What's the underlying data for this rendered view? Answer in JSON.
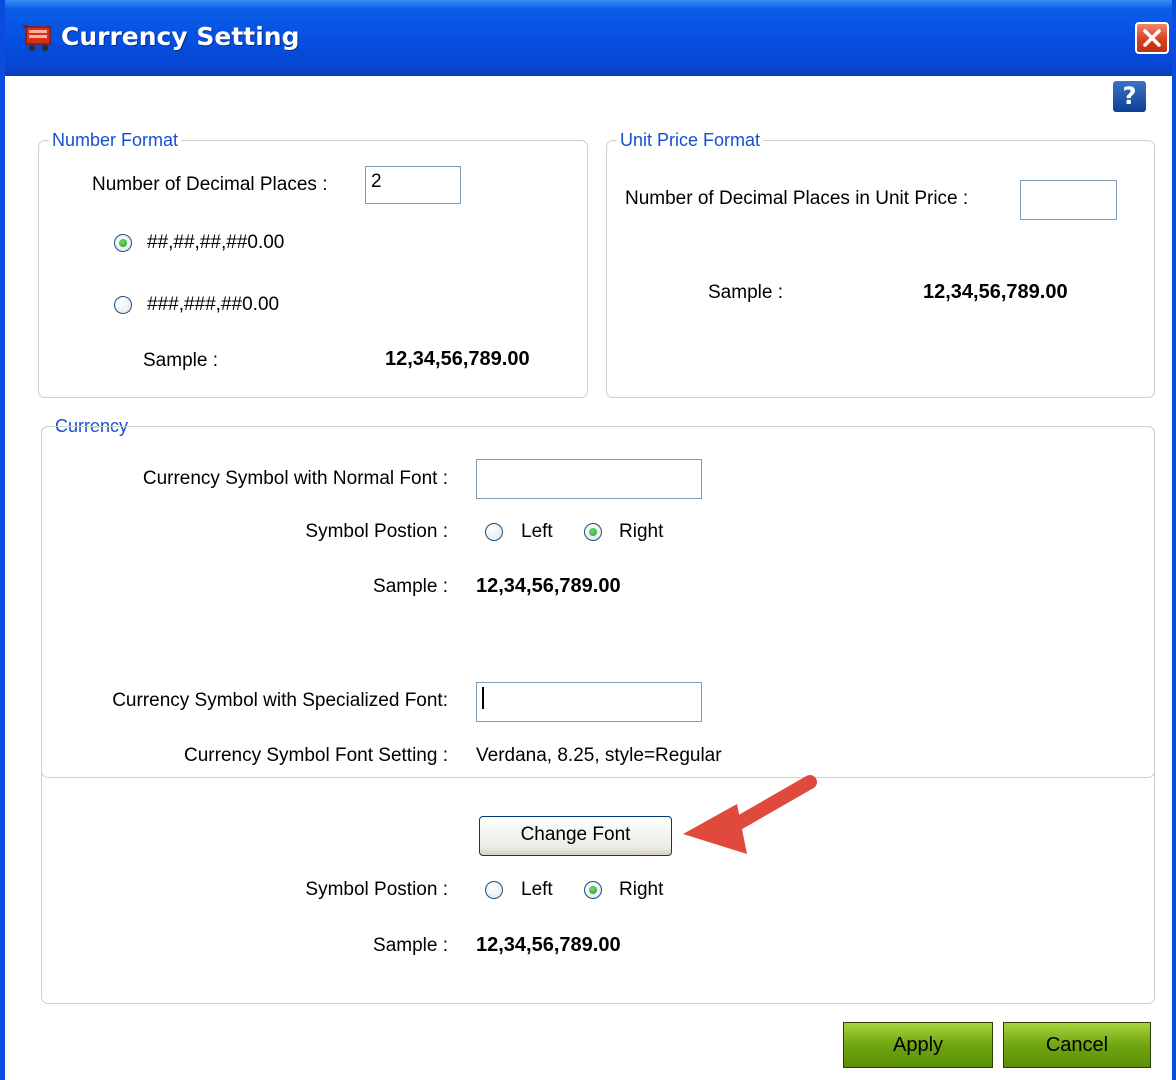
{
  "window": {
    "title": "Currency Setting",
    "help_label": "?"
  },
  "number_format": {
    "legend": "Number Format",
    "decimal_label": "Number of Decimal Places :",
    "decimal_value": "2",
    "options": [
      {
        "label": "##,##,##,##0.00",
        "selected": true
      },
      {
        "label": "###,###,##0.00",
        "selected": false
      }
    ],
    "sample_label": "Sample :",
    "sample_value": "12,34,56,789.00"
  },
  "unit_price_format": {
    "legend": "Unit Price Format",
    "decimal_label": "Number of Decimal Places in Unit Price :",
    "decimal_value": "",
    "sample_label": "Sample :",
    "sample_value": "12,34,56,789.00"
  },
  "currency": {
    "legend": "Currency",
    "normal": {
      "symbol_label": "Currency Symbol  with Normal Font :",
      "symbol_value": "",
      "position_label": "Symbol Postion :",
      "left_label": "Left",
      "right_label": "Right",
      "selected": "Right",
      "sample_label": "Sample :",
      "sample_value": "12,34,56,789.00"
    },
    "specialized": {
      "symbol_label": "Currency Symbol with Specialized Font:",
      "symbol_value": "",
      "font_setting_label": "Currency Symbol Font Setting :",
      "font_setting_value": "Verdana, 8.25, style=Regular",
      "change_font_label": "Change Font",
      "position_label": "Symbol Postion :",
      "left_label": "Left",
      "right_label": "Right",
      "selected": "Right",
      "sample_label": "Sample :",
      "sample_value": "12,34,56,789.00"
    }
  },
  "actions": {
    "apply_label": "Apply",
    "cancel_label": "Cancel"
  },
  "colors": {
    "title_bar": "#0650e0",
    "legend_text": "#1450d2",
    "action_buttons": "#6fa611",
    "annotation_arrow": "#e04a3c"
  }
}
